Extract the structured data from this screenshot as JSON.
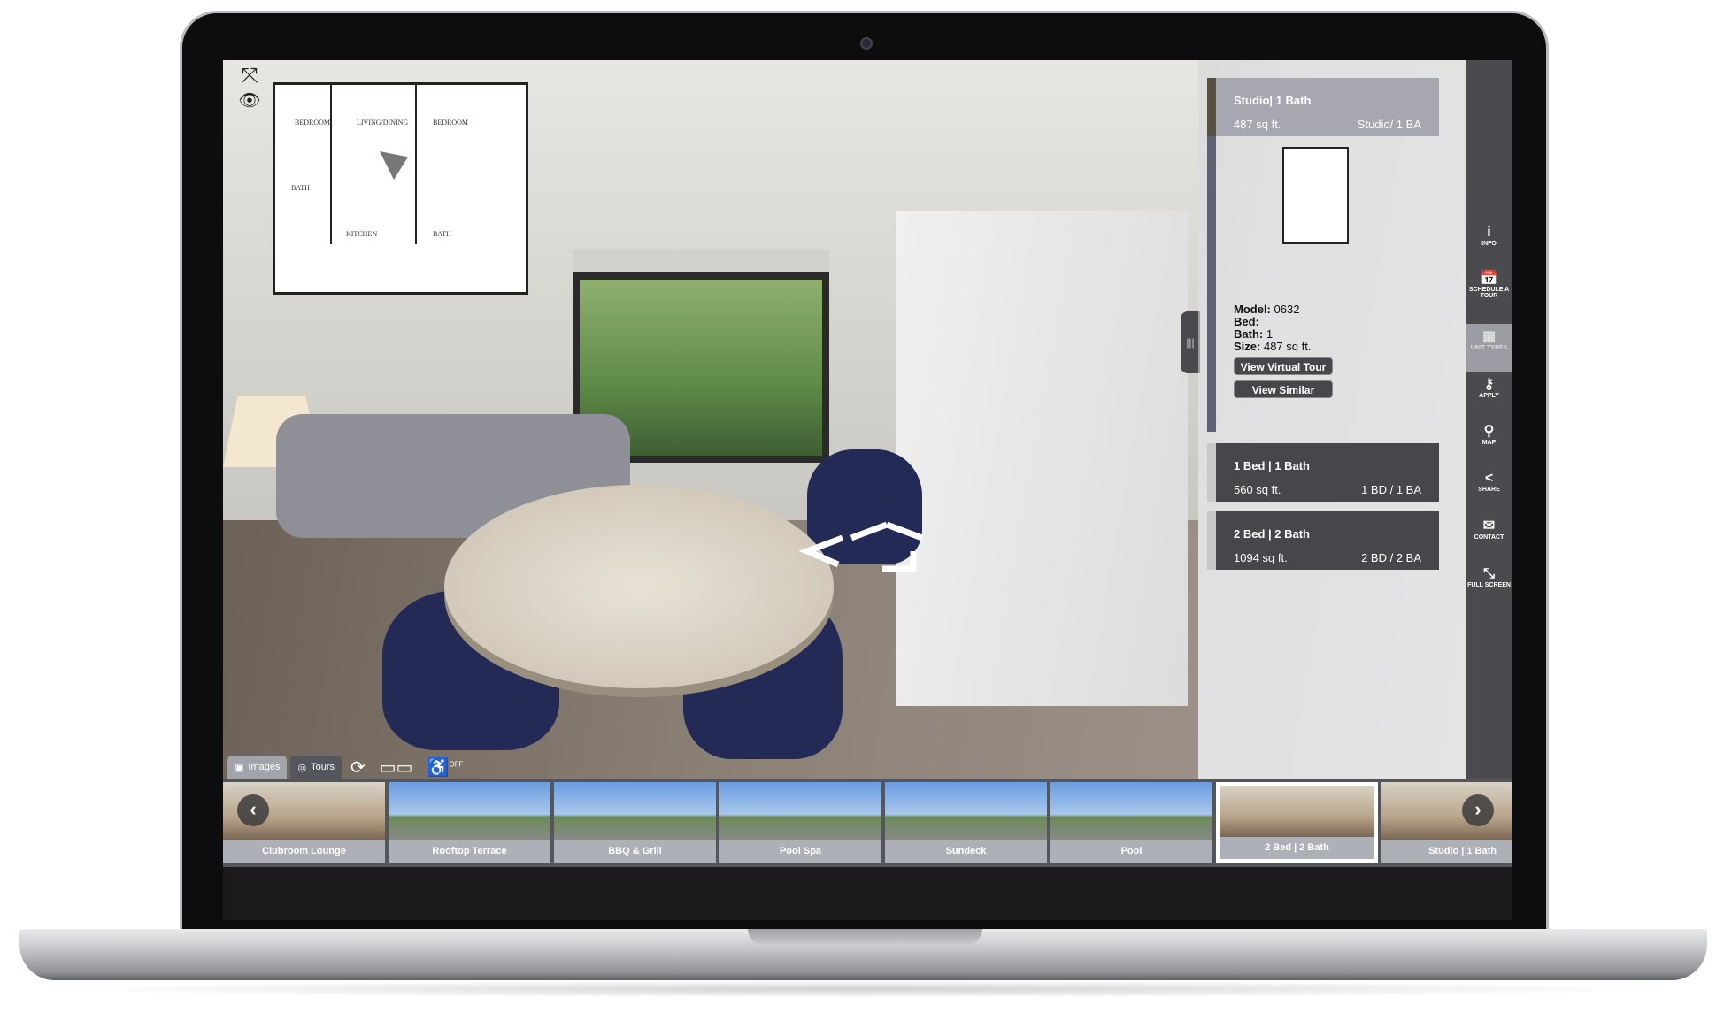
{
  "floorplan": {
    "rooms": [
      "BEDROOM",
      "LIVING/DINING",
      "BEDROOM",
      "BATH",
      "KITCHEN",
      "BATH"
    ]
  },
  "unit_cards": [
    {
      "title": "Studio| 1 Bath",
      "size": "487 sq ft.",
      "type": "Studio/ 1 BA"
    },
    {
      "title": "1 Bed | 1 Bath",
      "size": "560 sq ft.",
      "type": "1 BD / 1 BA"
    },
    {
      "title": "2 Bed | 2 Bath",
      "size": "1094 sq ft.",
      "type": "2 BD / 2 BA"
    }
  ],
  "details": {
    "model_label": "Model:",
    "model": "0632",
    "bed_label": "Bed:",
    "bed": "",
    "bath_label": "Bath:",
    "bath": "1",
    "size_label": "Size:",
    "size": "487 sq ft.",
    "virtual_tour": "View Virtual Tour",
    "view_similar": "View Similar"
  },
  "sidebar": [
    {
      "label": "INFO",
      "icon": "info-icon"
    },
    {
      "label": "SCHEDULE A TOUR",
      "icon": "calendar-icon"
    },
    {
      "label": "UNIT TYPES",
      "icon": "floorplan-icon",
      "selected": true
    },
    {
      "label": "APPLY",
      "icon": "key-icon"
    },
    {
      "label": "MAP",
      "icon": "map-pin-icon"
    },
    {
      "label": "SHARE",
      "icon": "share-icon"
    },
    {
      "label": "CONTACT",
      "icon": "envelope-icon"
    },
    {
      "label": "FULL SCREEN",
      "icon": "fullscreen-icon"
    }
  ],
  "tabs": {
    "images": "Images",
    "tours": "Tours",
    "accessibility": "OFF"
  },
  "thumbnails": [
    {
      "label": "Clubroom Lounge",
      "interior": true
    },
    {
      "label": "Rooftop Terrace"
    },
    {
      "label": "BBQ & Grill"
    },
    {
      "label": "Pool Spa"
    },
    {
      "label": "Sundeck"
    },
    {
      "label": "Pool"
    },
    {
      "label": "2 Bed | 2 Bath",
      "interior": true,
      "selected": true
    },
    {
      "label": "Studio | 1 Bath",
      "interior": true
    }
  ]
}
